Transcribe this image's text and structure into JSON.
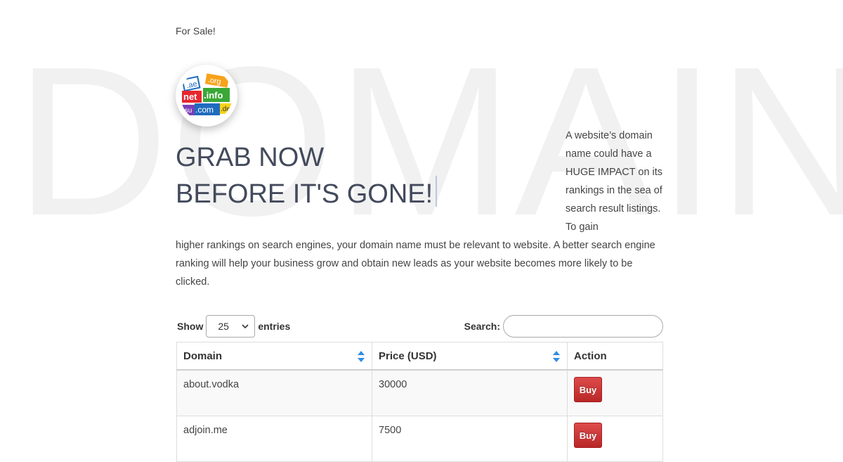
{
  "background_word": "DOMAIN",
  "header": {
    "for_sale": "For Sale!"
  },
  "logo": {
    "tags": [
      ".ae",
      ".org",
      "net",
      ".info",
      ".su",
      ".com",
      ".de"
    ]
  },
  "headline": {
    "line1": "GRAB NOW",
    "line2": "BEFORE IT'S GONE!"
  },
  "description": {
    "side": "A website’s domain name could have a HUGE IMPACT on its rankings in the sea of search result listings. To gain",
    "lower": "higher rankings on search engines, your domain name must be relevant to website. A better search engine ranking will help your business grow and obtain new leads as your website becomes more likely to be clicked."
  },
  "table_controls": {
    "show_label": "Show",
    "entries_value": "25",
    "entries_label": "entries",
    "search_label": "Search:",
    "search_value": ""
  },
  "table": {
    "columns": [
      "Domain",
      "Price (USD)",
      "Action"
    ],
    "rows": [
      {
        "domain": "about.vodka",
        "price": "30000",
        "action": "Buy"
      },
      {
        "domain": "adjoin.me",
        "price": "7500",
        "action": "Buy"
      }
    ]
  },
  "colors": {
    "headline": "#434a5c",
    "buy_button": "#c93030",
    "sort_arrow": "#2f8de4",
    "background_word": "#f1f1f1"
  }
}
